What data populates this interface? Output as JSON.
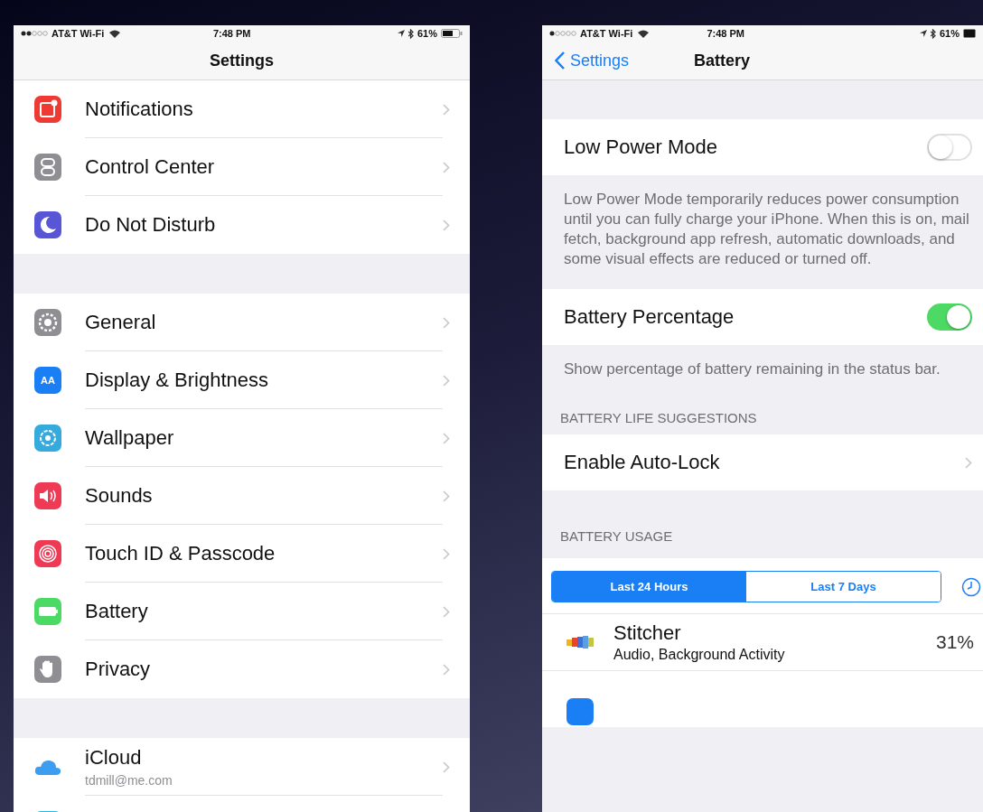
{
  "settings_screen": {
    "status_bar": {
      "carrier": "AT&T Wi-Fi",
      "time": "7:48 PM",
      "battery": "61%"
    },
    "title": "Settings",
    "groups": [
      [
        {
          "kind": "notifications",
          "color": "#ee3a33",
          "label": "Notifications"
        },
        {
          "kind": "control",
          "color": "#8e8e93",
          "label": "Control Center"
        },
        {
          "kind": "moon",
          "color": "#5856d6",
          "label": "Do Not Disturb"
        }
      ],
      [
        {
          "kind": "gear",
          "color": "#8e8e93",
          "label": "General"
        },
        {
          "kind": "text",
          "color": "#1a7ef5",
          "glyph": "AA",
          "label": "Display & Brightness"
        },
        {
          "kind": "flower",
          "color": "#35aadc",
          "label": "Wallpaper"
        },
        {
          "kind": "speaker",
          "color": "#ee3a55",
          "label": "Sounds"
        },
        {
          "kind": "fingerprint",
          "color": "#ee3a55",
          "label": "Touch ID & Passcode"
        },
        {
          "kind": "battery",
          "color": "#4cd964",
          "label": "Battery"
        },
        {
          "kind": "hand",
          "color": "#8e8e93",
          "label": "Privacy"
        }
      ],
      [
        {
          "kind": "cloud",
          "color": "#3d9df0",
          "label": "iCloud",
          "subtitle": "tdmill@me.com"
        },
        {
          "kind": "store",
          "color": "#1fb8e8"
        }
      ]
    ]
  },
  "battery_screen": {
    "status_bar": {
      "carrier": "AT&T Wi-Fi",
      "time": "7:48 PM",
      "battery": "61%"
    },
    "back": "Settings",
    "title": "Battery",
    "low_power": {
      "label": "Low Power Mode",
      "on": false
    },
    "low_power_note": "Low Power Mode temporarily reduces power consumption until you can fully charge your iPhone. When this is on, mail fetch, background app refresh, automatic downloads, and some visual effects are reduced or turned off.",
    "percentage": {
      "label": "Battery Percentage",
      "on": true
    },
    "percentage_note": "Show percentage of battery remaining in the status bar.",
    "suggestions_header": "BATTERY LIFE SUGGESTIONS",
    "suggestion": "Enable Auto-Lock",
    "usage_header": "BATTERY USAGE",
    "segments": [
      {
        "label": "Last 24 Hours",
        "selected": true
      },
      {
        "label": "Last 7 Days",
        "selected": false
      }
    ],
    "apps": [
      {
        "kind": "stitcher",
        "name": "Stitcher",
        "detail": "Audio, Background Activity",
        "percent": "31%"
      },
      {
        "kind": "mail"
      }
    ]
  }
}
